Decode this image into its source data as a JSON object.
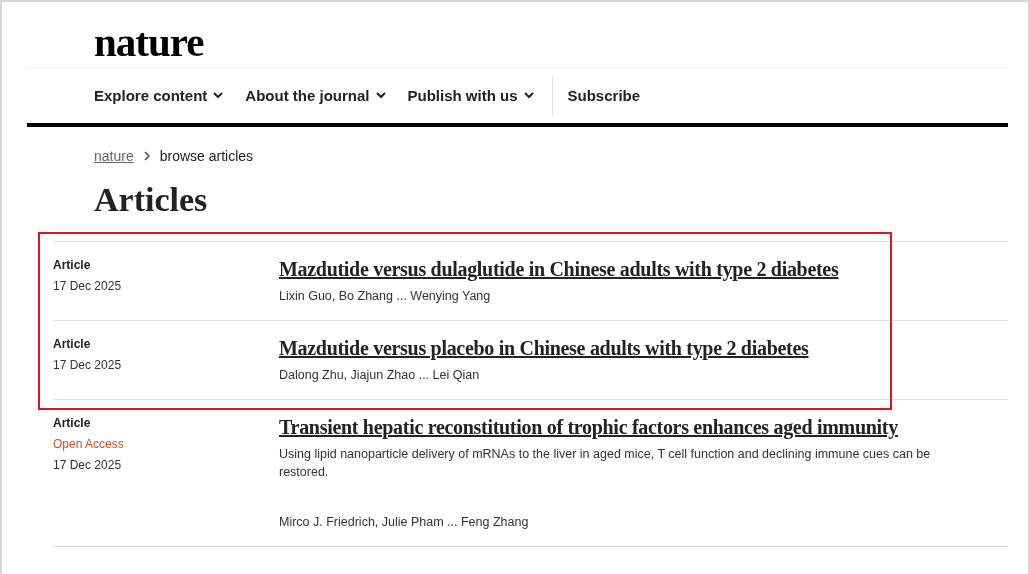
{
  "logo": "nature",
  "nav": [
    {
      "label": "Explore content",
      "dropdown": true
    },
    {
      "label": "About the journal",
      "dropdown": true
    },
    {
      "label": "Publish with us",
      "dropdown": true
    },
    {
      "label": "Subscribe",
      "dropdown": false
    }
  ],
  "breadcrumb": {
    "link": "nature",
    "current": "browse articles"
  },
  "heading": "Articles",
  "articles": [
    {
      "type": "Article",
      "open_access": false,
      "date": "17 Dec 2025",
      "title": "Mazdutide versus dulaglutide in Chinese adults with type 2 diabetes",
      "authors": "Lixin Guo, Bo Zhang ... Wenying Yang",
      "highlighted": true
    },
    {
      "type": "Article",
      "open_access": false,
      "date": "17 Dec 2025",
      "title": "Mazdutide versus placebo in Chinese adults with type 2 diabetes",
      "authors": "Dalong Zhu, Jiajun Zhao ... Lei Qian",
      "highlighted": true
    },
    {
      "type": "Article",
      "open_access": true,
      "access_label": "Open Access",
      "date": "17 Dec 2025",
      "title": "Transient hepatic reconstitution of trophic factors enhances aged immunity",
      "summary": "Using lipid nanoparticle delivery of mRNAs to the liver in aged mice, T cell function and declining immune cues can be restored.",
      "authors": "Mirco J. Friedrich, Julie Pham ... Feng Zhang",
      "highlighted": false
    }
  ]
}
